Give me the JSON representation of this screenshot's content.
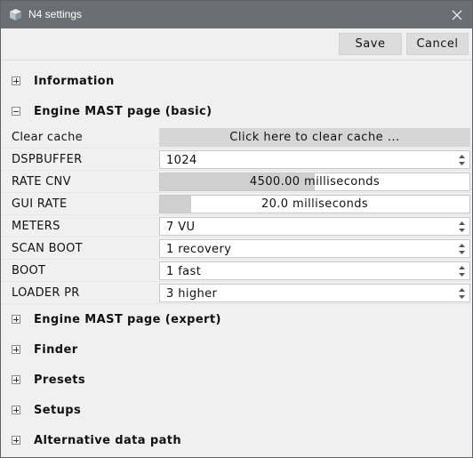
{
  "window": {
    "title": "N4 settings",
    "icon": "cube-icon"
  },
  "toolbar": {
    "save_label": "Save",
    "cancel_label": "Cancel"
  },
  "sections": {
    "information": {
      "label": "Information",
      "expanded": false
    },
    "engine_basic": {
      "label": "Engine MAST page (basic)",
      "expanded": true
    },
    "engine_expert": {
      "label": "Engine MAST page (expert)",
      "expanded": false
    },
    "finder": {
      "label": "Finder",
      "expanded": false
    },
    "presets": {
      "label": "Presets",
      "expanded": false
    },
    "setups": {
      "label": "Setups",
      "expanded": false
    },
    "alt_path": {
      "label": "Alternative data path",
      "expanded": false
    }
  },
  "settings": {
    "clear_cache": {
      "label": "Clear cache",
      "button": "Click here to clear cache ..."
    },
    "dspbuffer": {
      "label": "DSPBUFFER",
      "value": "1024"
    },
    "rate_cnv": {
      "label": "RATE CNV",
      "value": "4500.00 milliseconds",
      "fill_fraction": 0.5
    },
    "gui_rate": {
      "label": "GUI RATE",
      "value": "20.0 milliseconds",
      "fill_fraction": 0.1
    },
    "meters": {
      "label": "METERS",
      "value": "7 VU"
    },
    "scan_boot": {
      "label": "SCAN BOOT",
      "value": "1 recovery"
    },
    "boot": {
      "label": "BOOT",
      "value": "1 fast"
    },
    "loader_pr": {
      "label": "LOADER PR",
      "value": "3 higher"
    }
  }
}
